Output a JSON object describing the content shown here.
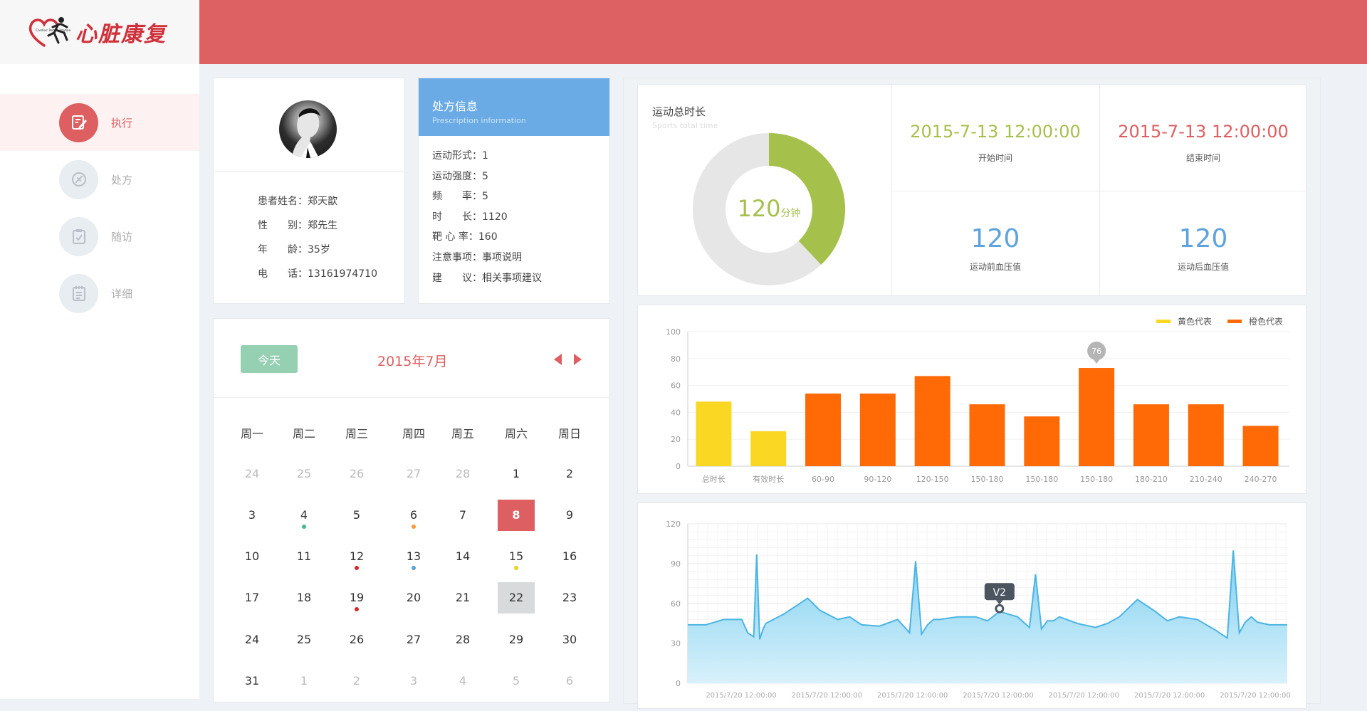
{
  "brand": {
    "name": "心脏康复",
    "emblem_text": "Cardiac Rehabilitation"
  },
  "nav": [
    {
      "label": "执行",
      "icon": "edit-icon",
      "active": true
    },
    {
      "label": "处方",
      "icon": "prescription-icon",
      "active": false
    },
    {
      "label": "随访",
      "icon": "clipboard-check-icon",
      "active": false
    },
    {
      "label": "详细",
      "icon": "document-icon",
      "active": false
    }
  ],
  "patient": {
    "rows": [
      "患者姓名：郑天歆",
      "性　　别：郑先生",
      "年　　龄：35岁",
      "电　　话：13161974710"
    ]
  },
  "prescription": {
    "title": "处方信息",
    "subtitle": "Prescription information",
    "rows": [
      "运动形式：1",
      "运动强度：5",
      "频　　率：5",
      "时　　长：1120",
      "靶 心 率：160",
      "注意事项：事项说明",
      "建　　议：相关事项建议"
    ]
  },
  "calendar": {
    "today_label": "今天",
    "month_label": "2015年7月",
    "weekdays": [
      "周一",
      "周二",
      "周三",
      "周四",
      "周五",
      "周六",
      "周日"
    ],
    "weeks": [
      [
        "24",
        "25",
        "26",
        "27",
        "28",
        "1",
        "2"
      ],
      [
        "3",
        "4",
        "5",
        "6",
        "7",
        "8",
        "9"
      ],
      [
        "10",
        "11",
        "12",
        "13",
        "14",
        "15",
        "16"
      ],
      [
        "17",
        "18",
        "19",
        "20",
        "21",
        "22",
        "23"
      ],
      [
        "24",
        "25",
        "26",
        "27",
        "28",
        "29",
        "30"
      ],
      [
        "31",
        "1",
        "2",
        "3",
        "4",
        "5",
        "6"
      ]
    ],
    "other_month": [
      [
        0,
        0
      ],
      [
        0,
        1
      ],
      [
        0,
        2
      ],
      [
        0,
        3
      ],
      [
        0,
        4
      ],
      [
        5,
        1
      ],
      [
        5,
        2
      ],
      [
        5,
        3
      ],
      [
        5,
        4
      ],
      [
        5,
        5
      ],
      [
        5,
        6
      ]
    ],
    "selected": [
      1,
      5
    ],
    "highlighted": [
      3,
      5
    ],
    "dots": [
      {
        "row": 1,
        "col": 1,
        "color": "#3cbf7f"
      },
      {
        "row": 1,
        "col": 3,
        "color": "#f39a42"
      },
      {
        "row": 2,
        "col": 2,
        "color": "#d9272d"
      },
      {
        "row": 2,
        "col": 3,
        "color": "#5aa0dd"
      },
      {
        "row": 2,
        "col": 5,
        "color": "#f0d020"
      },
      {
        "row": 3,
        "col": 2,
        "color": "#d9272d"
      }
    ]
  },
  "stats": {
    "duration_title": "运动总时长",
    "duration_subtitle": "Sports total time",
    "duration_value": "120",
    "duration_unit": "分钟",
    "duration_fraction": 0.38,
    "start_time": "2015-7-13 12:00:00",
    "start_label": "开始时间",
    "end_time": "2015-7-13 12:00:00",
    "end_label": "结束时间",
    "bp_before": "120",
    "bp_before_label": "运动前血压值",
    "bp_after": "120",
    "bp_after_label": "运动后血压值"
  },
  "colors": {
    "brand_red": "#dd6163",
    "green": "#a6c04c",
    "blue": "#5ea3dd",
    "yellow": "#fad722",
    "orange": "#ff6a07",
    "ecg_line": "#4bb4e4"
  },
  "chart_data": [
    {
      "type": "bar",
      "categories": [
        "总时长",
        "有效时长",
        "60-90",
        "90-120",
        "120-150",
        "150-180",
        "150-180",
        "150-180",
        "180-210",
        "210-240",
        "240-270"
      ],
      "series": [
        {
          "name": "黄色代表",
          "color": "#fad722",
          "values": [
            48,
            26,
            null,
            null,
            null,
            null,
            null,
            null,
            null,
            null,
            null
          ]
        },
        {
          "name": "橙色代表",
          "color": "#ff6a07",
          "values": [
            null,
            null,
            54,
            54,
            67,
            46,
            37,
            73,
            46,
            46,
            30
          ]
        }
      ],
      "highlight": {
        "index": 7,
        "label": "76"
      },
      "y_ticks": [
        0,
        20,
        40,
        60,
        80,
        100
      ],
      "ylim": [
        0,
        100
      ],
      "legend": "top-right",
      "grid": true
    },
    {
      "type": "area",
      "y_ticks": [
        0,
        30,
        60,
        90,
        120
      ],
      "ylim": [
        0,
        120
      ],
      "x_labels": [
        "2015/7/20 12:00:00",
        "2015/7/20 12:00:00",
        "2015/7/20 12:00:00",
        "2015/7/20 12:00:00",
        "2015/7/20 12:00:00",
        "2015/7/20 12:00:00",
        "2015/7/20 12:00:00"
      ],
      "annotation": {
        "label": "V2",
        "x": 52,
        "y": 54
      },
      "x": [
        0,
        3,
        6,
        9,
        10,
        11,
        11.5,
        12,
        12.5,
        13,
        16,
        20,
        22,
        25,
        27,
        29,
        32,
        35,
        37,
        38,
        39,
        40,
        41,
        42,
        45,
        48,
        50,
        52,
        55,
        57,
        58,
        59,
        60,
        61,
        62,
        65,
        68,
        70,
        72,
        75,
        78,
        80,
        82,
        85,
        88,
        90,
        91,
        92,
        93,
        94,
        95,
        97,
        100
      ],
      "y": [
        44,
        44,
        48,
        48,
        38,
        35,
        97,
        33,
        40,
        45,
        52,
        64,
        55,
        48,
        50,
        44,
        43,
        48,
        38,
        92,
        37,
        44,
        48,
        48,
        50,
        50,
        47,
        54,
        50,
        42,
        82,
        41,
        47,
        47,
        50,
        45,
        42,
        45,
        50,
        63,
        54,
        47,
        50,
        48,
        40,
        34,
        100,
        38,
        46,
        50,
        46,
        44,
        44
      ],
      "grid": true
    }
  ]
}
